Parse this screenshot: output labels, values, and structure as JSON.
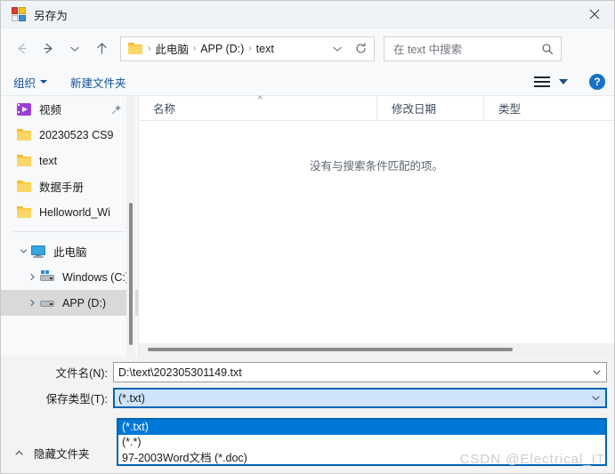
{
  "window": {
    "title": "另存为",
    "app_icon": "save-as-icon",
    "close_label": "×"
  },
  "nav": {
    "back": "back-arrow",
    "forward": "forward-arrow",
    "recent": "recent-locations-chevron",
    "up": "up-arrow",
    "breadcrumb": {
      "folder_icon": "folder-icon",
      "segments": [
        "此电脑",
        "APP (D:)",
        "text"
      ],
      "separator": "›",
      "dropdown_icon": "chevron-down-icon",
      "refresh_icon": "refresh-icon"
    },
    "search": {
      "placeholder": "在 text 中搜索",
      "value": "",
      "icon": "search-icon"
    }
  },
  "commandbar": {
    "organize_label": "组织",
    "new_folder_label": "新建文件夹",
    "view_icon": "view-list-icon",
    "view_caret": "chevron-down-icon",
    "help_label": "?"
  },
  "sidebar": {
    "items": [
      {
        "label": "视频",
        "icon": "video-folder-icon",
        "indent": 1,
        "pinned": true,
        "expander": false,
        "selected": false
      },
      {
        "label": "20230523 CS9",
        "icon": "folder-icon",
        "indent": 1,
        "pinned": false,
        "expander": false,
        "selected": false
      },
      {
        "label": "text",
        "icon": "folder-icon",
        "indent": 1,
        "pinned": false,
        "expander": false,
        "selected": false
      },
      {
        "label": "数据手册",
        "icon": "folder-icon",
        "indent": 1,
        "pinned": false,
        "expander": false,
        "selected": false
      },
      {
        "label": "Helloworld_Wi",
        "icon": "folder-icon",
        "indent": 1,
        "pinned": false,
        "expander": false,
        "selected": false
      }
    ],
    "tree": [
      {
        "label": "此电脑",
        "icon": "this-pc-icon",
        "indent": 1,
        "expander": "expanded",
        "selected": false
      },
      {
        "label": "Windows (C:)",
        "icon": "windows-drive-icon",
        "indent": 2,
        "expander": "collapsed",
        "selected": false
      },
      {
        "label": "APP (D:)",
        "icon": "drive-icon",
        "indent": 2,
        "expander": "collapsed",
        "selected": true
      }
    ],
    "scrollbar": "vertical-scrollbar"
  },
  "filelist": {
    "columns": [
      {
        "label": "名称",
        "sorted": "asc"
      },
      {
        "label": "修改日期",
        "sorted": ""
      },
      {
        "label": "类型",
        "sorted": ""
      }
    ],
    "rows": [],
    "empty_message": "没有与搜索条件匹配的项。",
    "hscrollbar": "horizontal-scrollbar"
  },
  "form": {
    "filename": {
      "label": "文件名(N):",
      "value": "D:\\text\\202305301149.txt",
      "arrow": "chevron-down-icon"
    },
    "savetype": {
      "label": "保存类型(T):",
      "value": "(*.txt)",
      "arrow": "chevron-down-icon",
      "open": true,
      "options": [
        {
          "label": "(*.txt)",
          "selected": true
        },
        {
          "label": "(*.*)",
          "selected": false
        },
        {
          "label": "97-2003Word文档 (*.doc)",
          "selected": false
        }
      ]
    },
    "hide_folders_label": "隐藏文件夹",
    "hide_folders_icon": "chevron-up-icon"
  },
  "watermark": "CSDN @Electrical_IT",
  "colors": {
    "accent": "#0078d7",
    "focus_border": "#0063b1",
    "link": "#0f4f9c",
    "titlebar": "#eff3f8",
    "selection": "#d9d9d9"
  }
}
